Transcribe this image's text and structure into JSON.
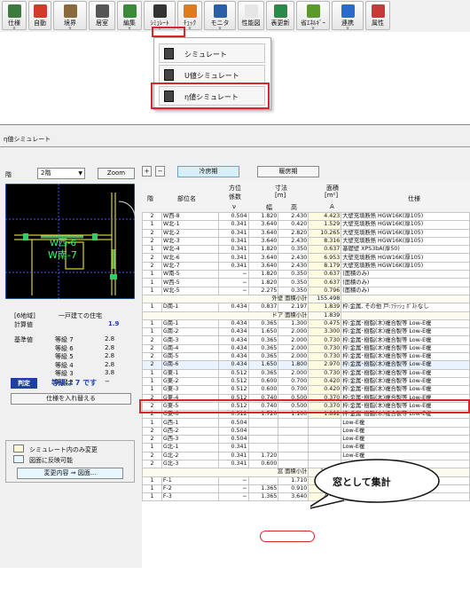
{
  "toolbar": {
    "buttons": [
      {
        "label": "仕様",
        "icon": "spec-icon",
        "color": "#3d7a3d"
      },
      {
        "label": "自動",
        "icon": "auto-icon",
        "color": "#d23b2b"
      },
      {
        "label": "境界",
        "icon": "boundary-icon",
        "color": "#8a6a3a"
      },
      {
        "label": "居室",
        "icon": "room-icon",
        "color": "#555555"
      },
      {
        "label": "編集",
        "icon": "edit-icon",
        "color": "#3a8a3a"
      },
      {
        "label": "ｼﾐｭﾚｰﾄ",
        "icon": "simulate-icon",
        "color": "#333333"
      },
      {
        "label": "ﾁｪｯｸ",
        "icon": "check-icon",
        "color": "#e07b1c"
      },
      {
        "label": "モニタ",
        "icon": "monitor-icon",
        "color": "#2a5fa8"
      },
      {
        "label": "性能図",
        "icon": "performance-icon",
        "color": "#e6e6e6"
      },
      {
        "label": "表更新",
        "icon": "refresh-icon",
        "color": "#2a8a4a"
      },
      {
        "label": "省ｴﾈﾙｷﾞｰ",
        "icon": "energy-icon",
        "color": "#5a9a2a"
      },
      {
        "label": "連携",
        "icon": "link-icon",
        "color": "#2a6ac8"
      },
      {
        "label": "属性",
        "icon": "attribute-icon",
        "color": "#c83a3a"
      }
    ]
  },
  "dropdown": {
    "items": [
      "シミュレート",
      "U値シミュレート",
      "η値シミュレート"
    ]
  },
  "window": {
    "title": "η値シミュレート",
    "floor_label": "階",
    "floor_value": "2階",
    "zoom_label": "Zoom",
    "plus": "+",
    "minus": "−",
    "tab_cooling": "冷房期",
    "tab_heating": "暖房期"
  },
  "plan": {
    "room_labels": [
      "W西-6",
      "W南-7"
    ]
  },
  "info": {
    "region": "[6地域]",
    "house_type": "一戸建ての住宅",
    "calc_label": "計算値",
    "calc_value": "1.9",
    "standard_label": "基準値",
    "grades": [
      {
        "label": "等級 7",
        "value": "2.8"
      },
      {
        "label": "等級 6",
        "value": "2.8"
      },
      {
        "label": "等級 5",
        "value": "2.8"
      },
      {
        "label": "等級 4",
        "value": "2.8"
      },
      {
        "label": "等級 3",
        "value": "3.8"
      },
      {
        "label": "等級 2",
        "value": "−"
      }
    ],
    "judge_label": "判定",
    "judge_value": "等級は 7 です",
    "replace_button": "仕様を入れ替える",
    "legend_sim_only": "シミュレート内のみ変更",
    "legend_reflect": "図面に反映可能",
    "change_button": "変更内容 ⇒ 図面..."
  },
  "table": {
    "headers": {
      "floor": "階",
      "part": "部位名",
      "direction": "方位係数",
      "direction_unit": "ν",
      "size": "寸法",
      "size_unit": "[m]",
      "width": "幅",
      "height": "高",
      "area": "面積",
      "area_unit": "[m²]",
      "area_sym": "A",
      "spec": "仕様"
    },
    "rows": [
      {
        "f": "2",
        "n": "W西-8",
        "v": "0.504",
        "w": "1.820",
        "h": "2.430",
        "a": "4.423",
        "s": "大壁充填断熱 HGW16K(厚105)"
      },
      {
        "f": "1",
        "n": "W北-1",
        "v": "0.341",
        "w": "3.640",
        "h": "0.420",
        "a": "1.529",
        "s": "大壁充填断熱 HGW16K(厚105)"
      },
      {
        "f": "2",
        "n": "W北-2",
        "v": "0.341",
        "w": "3.640",
        "h": "2.820",
        "a": "10.265",
        "s": "大壁充填断熱 HGW16K(厚105)"
      },
      {
        "f": "2",
        "n": "W北-3",
        "v": "0.341",
        "w": "3.640",
        "h": "2.430",
        "a": "8.316",
        "s": "大壁充填断熱 HGW16K(厚105)"
      },
      {
        "f": "1",
        "n": "W北-4",
        "v": "0.341",
        "w": "1.820",
        "h": "0.350",
        "a": "0.637",
        "s": "基礎壁 XPS3bA(厚50)"
      },
      {
        "f": "2",
        "n": "W北-6",
        "v": "0.341",
        "w": "3.640",
        "h": "2.430",
        "a": "6.953",
        "s": "大壁充填断熱 HGW16K(厚105)"
      },
      {
        "f": "2",
        "n": "W北-7",
        "v": "0.341",
        "w": "3.640",
        "h": "2.430",
        "a": "8.179",
        "s": "大壁充填断熱 HGW16K(厚105)"
      },
      {
        "f": "1",
        "n": "W南-5",
        "v": "−",
        "w": "1.820",
        "h": "0.350",
        "a": "0.637",
        "s": "(面積のみ)"
      },
      {
        "f": "1",
        "n": "W西-5",
        "v": "−",
        "w": "1.820",
        "h": "0.350",
        "a": "0.637",
        "s": "(面積のみ)"
      },
      {
        "f": "1",
        "n": "W北-5",
        "v": "−",
        "w": "2.275",
        "h": "0.350",
        "a": "0.796",
        "s": "(面積のみ)"
      },
      {
        "sum": "外壁  面積小計",
        "a": "155.498"
      },
      {
        "f": "1",
        "n": "D南-1",
        "v": "0.434",
        "w": "0.837",
        "h": "2.197",
        "a": "1.839",
        "s": "枠:金属, その他 戸:ﾌﾗｯｼｭ ﾎﾟｽﾄなし"
      },
      {
        "sum": "ドア  面積小計",
        "a": "1.839"
      },
      {
        "f": "1",
        "n": "G南-1",
        "v": "0.434",
        "w": "0.365",
        "h": "1.300",
        "a": "0.475",
        "s": "枠:金属･樹脂(木)複合製等 Low-E複"
      },
      {
        "f": "1",
        "n": "G南-2",
        "v": "0.434",
        "w": "1.650",
        "h": "2.000",
        "a": "3.300",
        "s": "枠:金属･樹脂(木)複合製等 Low-E複"
      },
      {
        "f": "2",
        "n": "G南-3",
        "v": "0.434",
        "w": "0.365",
        "h": "2.000",
        "a": "0.730",
        "s": "枠:金属･樹脂(木)複合製等 Low-E複"
      },
      {
        "f": "2",
        "n": "G南-4",
        "v": "0.434",
        "w": "0.365",
        "h": "2.000",
        "a": "0.730",
        "s": "枠:金属･樹脂(木)複合製等 Low-E複"
      },
      {
        "f": "2",
        "n": "G南-5",
        "v": "0.434",
        "w": "0.365",
        "h": "2.000",
        "a": "0.730",
        "s": "枠:金属･樹脂(木)複合製等 Low-E複"
      },
      {
        "f": "2",
        "n": "G南-6",
        "v": "0.434",
        "w": "1.650",
        "h": "1.800",
        "a": "2.970",
        "s": "枠:金属･樹脂(木)複合製等 Low-E複",
        "hl": true
      },
      {
        "f": "1",
        "n": "G東-1",
        "v": "0.512",
        "w": "0.365",
        "h": "2.000",
        "a": "0.730",
        "s": "枠:金属･樹脂(木)複合製等 Low-E複"
      },
      {
        "f": "1",
        "n": "G東-2",
        "v": "0.512",
        "w": "0.600",
        "h": "0.700",
        "a": "0.420",
        "s": "枠:金属･樹脂(木)複合製等 Low-E複"
      },
      {
        "f": "1",
        "n": "G東-3",
        "v": "0.512",
        "w": "0.600",
        "h": "0.700",
        "a": "0.420",
        "s": "枠:金属･樹脂(木)複合製等 Low-E複"
      },
      {
        "f": "2",
        "n": "G東-4",
        "v": "0.512",
        "w": "0.740",
        "h": "0.500",
        "a": "0.370",
        "s": "枠:金属･樹脂(木)複合製等 Low-E複"
      },
      {
        "f": "2",
        "n": "G東-5",
        "v": "0.512",
        "w": "0.740",
        "h": "0.500",
        "a": "0.370",
        "s": "枠:金属･樹脂(木)複合製等 Low-E複"
      },
      {
        "f": "2",
        "n": "G東-6",
        "v": "0.512",
        "w": "1.720",
        "h": "1.100",
        "a": "1.892",
        "s": "枠:金属･樹脂(木)複合製等 Low-E複"
      },
      {
        "f": "1",
        "n": "G西-1",
        "v": "0.504",
        "w": "",
        "h": "",
        "a": "",
        "s": "Low-E複"
      },
      {
        "f": "2",
        "n": "G西-2",
        "v": "0.504",
        "w": "",
        "h": "",
        "a": "",
        "s": "Low-E複"
      },
      {
        "f": "2",
        "n": "G西-3",
        "v": "0.504",
        "w": "",
        "h": "",
        "a": "",
        "s": "Low-E複"
      },
      {
        "f": "1",
        "n": "G北-1",
        "v": "0.341",
        "w": "",
        "h": "",
        "a": "",
        "s": "Low-E複"
      },
      {
        "f": "2",
        "n": "G北-2",
        "v": "0.341",
        "w": "1.720",
        "h": "",
        "a": "",
        "s": "Low-E複"
      },
      {
        "f": "2",
        "n": "G北-3",
        "v": "0.341",
        "w": "0.600",
        "h": "",
        "a": "",
        "s": ""
      },
      {
        "sum": "窓  面積小計",
        "a": "20.067"
      },
      {
        "f": "1",
        "n": "F-1",
        "v": "−",
        "w": "",
        "h": "1.710",
        "a": "1.556",
        "s": "(面積のみ)"
      },
      {
        "f": "1",
        "n": "F-2",
        "v": "−",
        "w": "1.365",
        "h": "0.910",
        "a": "1.242",
        "s": "(面積のみ)"
      },
      {
        "f": "1",
        "n": "F-3",
        "v": "−",
        "w": "1.365",
        "h": "3.640",
        "a": "4.969",
        "s": "(面積のみ)"
      }
    ]
  },
  "callout": {
    "text": "窓として集計"
  },
  "colors": {
    "highlight_red": "#d9262b",
    "judge_bg": "#1f3fa3",
    "sim_only": "#fff8d8",
    "reflect": "#e8f6ff"
  }
}
